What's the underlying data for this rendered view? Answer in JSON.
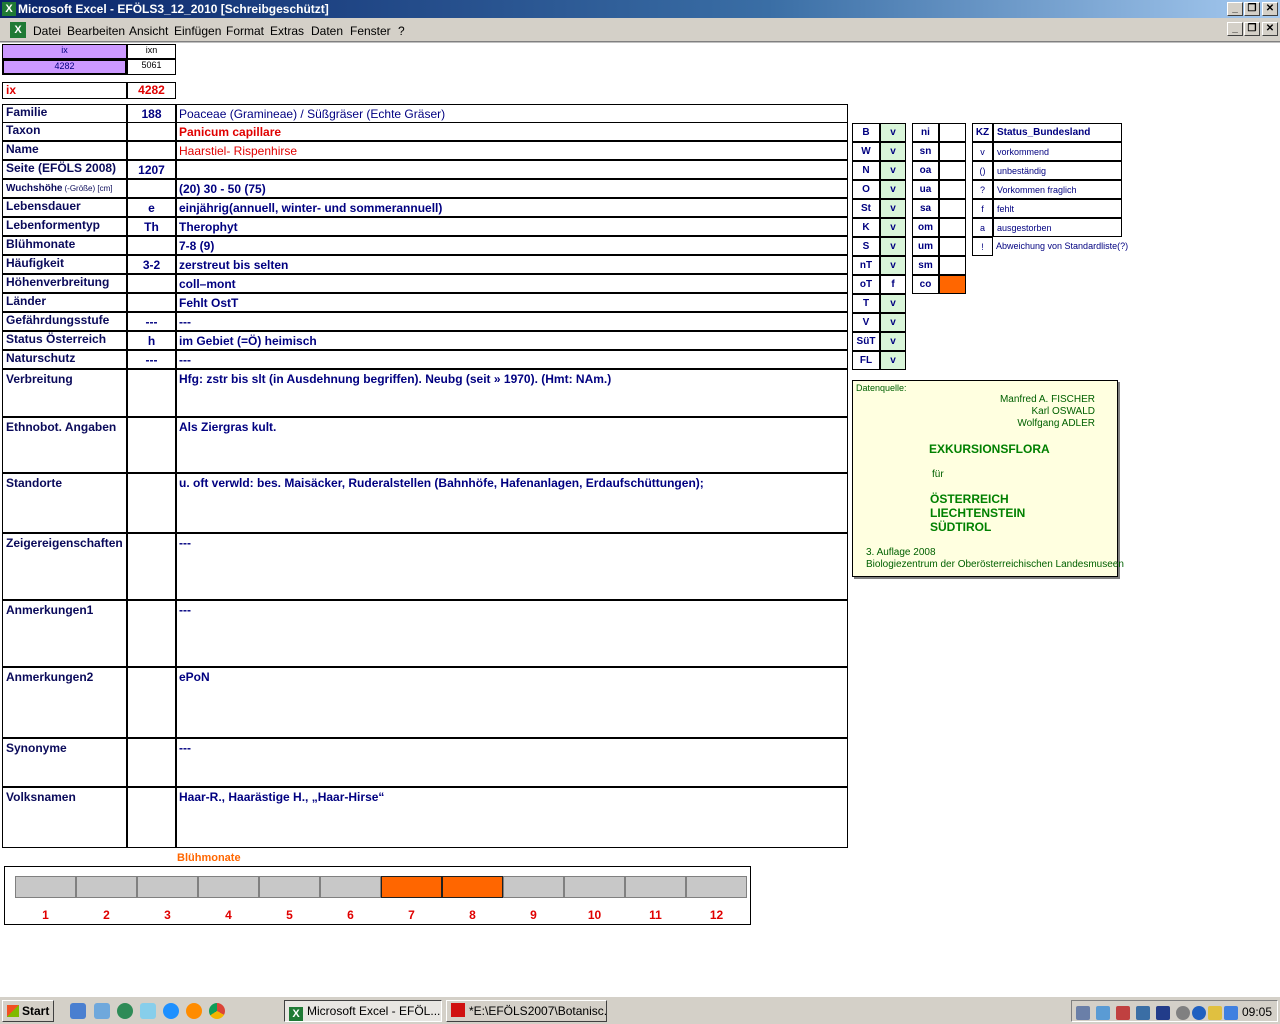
{
  "window": {
    "title": "Microsoft Excel - EFÖLS3_12_2010  [Schreibgeschützt]",
    "app_icon": "excel-icon",
    "buttons": {
      "minimize": "_",
      "restore": "❐",
      "close": "✕"
    }
  },
  "menu": {
    "items": [
      "Datei",
      "Bearbeiten",
      "Ansicht",
      "Einfügen",
      "Format",
      "Extras",
      "Daten",
      "Fenster",
      "?"
    ]
  },
  "index": {
    "ix_label": "ix",
    "ixn_label": "ixn",
    "ix_value": "4282",
    "ixn_value": "5061",
    "ix2_label": "ix",
    "ix2_value": "4282"
  },
  "record": {
    "rows": [
      {
        "label": "Familie",
        "code": "188",
        "value": "Poaceae (Gramineae)  /  Süßgräser (Echte Gräser)"
      },
      {
        "label": "Taxon",
        "code": "",
        "value": "Panicum capillare"
      },
      {
        "label": "Name",
        "code": "",
        "value": "Haarstiel- Rispenhirse"
      },
      {
        "label": "Seite (EFÖLS 2008)",
        "code": "1207",
        "value": ""
      },
      {
        "label": "Wuchshöhe",
        "label_suffix": "(-Größe) [cm]",
        "code": "",
        "value": " (20) 30 - 50 (75)"
      },
      {
        "label": "Lebensdauer",
        "code": "e",
        "value": "einjährig(annuell, winter- und sommerannuell)"
      },
      {
        "label": "Lebenformentyp",
        "code": "Th",
        "value": "Therophyt"
      },
      {
        "label": "Blühmonate",
        "code": "",
        "value": " 7-8 (9)"
      },
      {
        "label": "Häufigkeit",
        "code": "3-2",
        "value": "zerstreut bis selten"
      },
      {
        "label": "Höhenverbreitung",
        "code": "",
        "value": "coll–mont"
      },
      {
        "label": "Länder",
        "code": "",
        "value": "Fehlt OstT"
      },
      {
        "label": "Gefährdungsstufe",
        "code": "---",
        "value": "  ---"
      },
      {
        "label": "Status Österreich",
        "code": "h",
        "value": "im Gebiet (=Ö) heimisch"
      },
      {
        "label": "Naturschutz",
        "code": "---",
        "value": " ---"
      }
    ],
    "blocks": [
      {
        "label": "Verbreitung",
        "value": "Hfg: zstr bis slt (in Ausdehnung begriffen). Neubg (seit » 1970). (Hmt: NAm.)"
      },
      {
        "label": "Ethnobot. Angaben",
        "value": "Als Ziergras kult."
      },
      {
        "label": "Standorte",
        "value": "u. oft verwld: bes. Maisäcker, Ruderalstellen (Bahnhöfe, Hafenanlagen, Erdaufschüttungen);"
      },
      {
        "label": "Zeigereigenschaften",
        "value": "---"
      },
      {
        "label": "Anmerkungen1",
        "value": "---"
      },
      {
        "label": "Anmerkungen2",
        "value": "ePoN"
      },
      {
        "label": "Synonyme",
        "value": "---"
      },
      {
        "label": "Volksnamen",
        "value": "Haar-R., Haarästige H., „Haar-Hirse“"
      }
    ]
  },
  "states": {
    "left": [
      {
        "code": "B",
        "status": "v"
      },
      {
        "code": "W",
        "status": "v"
      },
      {
        "code": "N",
        "status": "v"
      },
      {
        "code": "O",
        "status": "v"
      },
      {
        "code": "St",
        "status": "v"
      },
      {
        "code": "K",
        "status": "v"
      },
      {
        "code": "S",
        "status": "v"
      },
      {
        "code": "nT",
        "status": "v"
      },
      {
        "code": "oT",
        "status": "f"
      },
      {
        "code": "T",
        "status": "v"
      },
      {
        "code": "V",
        "status": "v"
      },
      {
        "code": "SüT",
        "status": "v"
      },
      {
        "code": "FL",
        "status": "v"
      }
    ],
    "right": [
      {
        "code": "ni",
        "status": ""
      },
      {
        "code": "sn",
        "status": ""
      },
      {
        "code": "oa",
        "status": ""
      },
      {
        "code": "ua",
        "status": ""
      },
      {
        "code": "sa",
        "status": ""
      },
      {
        "code": "om",
        "status": ""
      },
      {
        "code": "um",
        "status": ""
      },
      {
        "code": "sm",
        "status": ""
      },
      {
        "code": "co",
        "status": ""
      }
    ]
  },
  "legend": {
    "header_code": "KZ",
    "header_label": "Status_Bundesland",
    "items": [
      {
        "code": "v",
        "label": "vorkommend"
      },
      {
        "code": "()",
        "label": "unbeständig"
      },
      {
        "code": "?",
        "label": "Vorkommen fraglich"
      },
      {
        "code": "f",
        "label": "fehlt"
      },
      {
        "code": "a",
        "label": "ausgestorben"
      },
      {
        "code": "!",
        "label": "Abweichung von Standardliste(?)"
      }
    ]
  },
  "datenquelle": {
    "heading": "Datenquelle:",
    "authors": [
      "Manfred A. FISCHER",
      "Karl OSWALD",
      "Wolfgang ADLER"
    ],
    "title": "EXKURSIONSFLORA",
    "fuer": "für",
    "regions": [
      "ÖSTERREICH",
      "LIECHTENSTEIN",
      "SÜDTIROL"
    ],
    "edition": "3. Auflage 2008",
    "publisher": "Biologiezentrum der Oberösterreichischen Landesmuseen"
  },
  "bloom": {
    "title": "Blühmonate",
    "months": [
      "1",
      "2",
      "3",
      "4",
      "5",
      "6",
      "7",
      "8",
      "9",
      "10",
      "11",
      "12"
    ],
    "active": [
      7,
      8
    ],
    "active_color": "#ff6600",
    "inactive_color": "#c8c8c8"
  },
  "taskbar": {
    "start": "Start",
    "tasks": [
      "Microsoft Excel - EFÖL...",
      "*E:\\EFÖLS2007\\Botanisc..."
    ],
    "clock": "09:05"
  },
  "colors": {
    "title_gradient_start": "#0a246a",
    "ix_header_bg": "#cc99ff",
    "green_status_bg": "#d9f5d9",
    "orange_marker": "#ff6600",
    "taxon_red": "#e00000"
  }
}
